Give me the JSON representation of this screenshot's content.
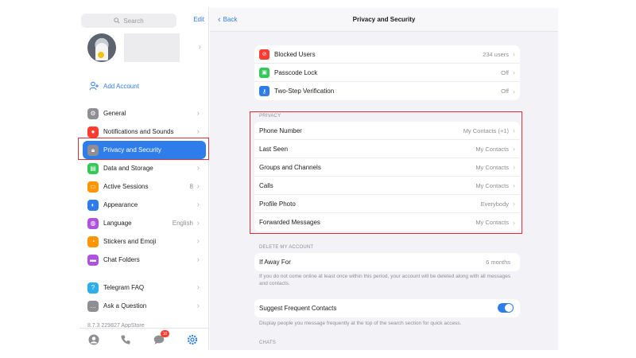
{
  "sidebar": {
    "search_placeholder": "Search",
    "edit_label": "Edit",
    "add_account_label": "Add Account",
    "items": [
      {
        "label": "General",
        "value": "",
        "color": "#8e8e93"
      },
      {
        "label": "Notifications and Sounds",
        "value": "",
        "color": "#ff3b30"
      },
      {
        "label": "Privacy and Security",
        "value": "",
        "color": "#8e8e93",
        "active": true
      },
      {
        "label": "Data and Storage",
        "value": "",
        "color": "#34c759"
      },
      {
        "label": "Active Sessions",
        "value": "8",
        "color": "#ff9500"
      },
      {
        "label": "Appearance",
        "value": "",
        "color": "#2f7dea"
      },
      {
        "label": "Language",
        "value": "English",
        "color": "#af52de"
      },
      {
        "label": "Stickers and Emoji",
        "value": "",
        "color": "#ff9500"
      },
      {
        "label": "Chat Folders",
        "value": "",
        "color": "#af52de"
      }
    ],
    "help_items": [
      {
        "label": "Telegram FAQ",
        "color": "#30aeea"
      },
      {
        "label": "Ask a Question",
        "color": "#8e8e93"
      }
    ],
    "version": "8.7.3 229827 AppStore",
    "tabs": {
      "chats_badge": "10"
    }
  },
  "main": {
    "back_label": "Back",
    "title": "Privacy and Security",
    "security_rows": [
      {
        "label": "Blocked Users",
        "value": "234 users",
        "color": "#ff3b30",
        "icon": "block-icon"
      },
      {
        "label": "Passcode Lock",
        "value": "Off",
        "color": "#34c759",
        "icon": "lock-icon"
      },
      {
        "label": "Two-Step Verification",
        "value": "Off",
        "color": "#2f7dea",
        "icon": "key-icon"
      }
    ],
    "privacy_header": "PRIVACY",
    "privacy_rows": [
      {
        "label": "Phone Number",
        "value": "My Contacts (+1)"
      },
      {
        "label": "Last Seen",
        "value": "My Contacts"
      },
      {
        "label": "Groups and Channels",
        "value": "My Contacts"
      },
      {
        "label": "Calls",
        "value": "My Contacts"
      },
      {
        "label": "Profile Photo",
        "value": "Everybody"
      },
      {
        "label": "Forwarded Messages",
        "value": "My Contacts"
      }
    ],
    "delete_header": "DELETE MY ACCOUNT",
    "if_away_label": "If Away For",
    "if_away_value": "6 months",
    "delete_footnote": "If you do not come online at least once within this period, your account will be deleted along with all messages and contacts.",
    "suggest_label": "Suggest Frequent Contacts",
    "suggest_on": true,
    "suggest_footnote": "Display people you message frequently at the top of the search section for quick access.",
    "chats_header": "CHATS"
  },
  "colors": {
    "accent": "#2f7dea",
    "highlight": "#d9303a"
  }
}
